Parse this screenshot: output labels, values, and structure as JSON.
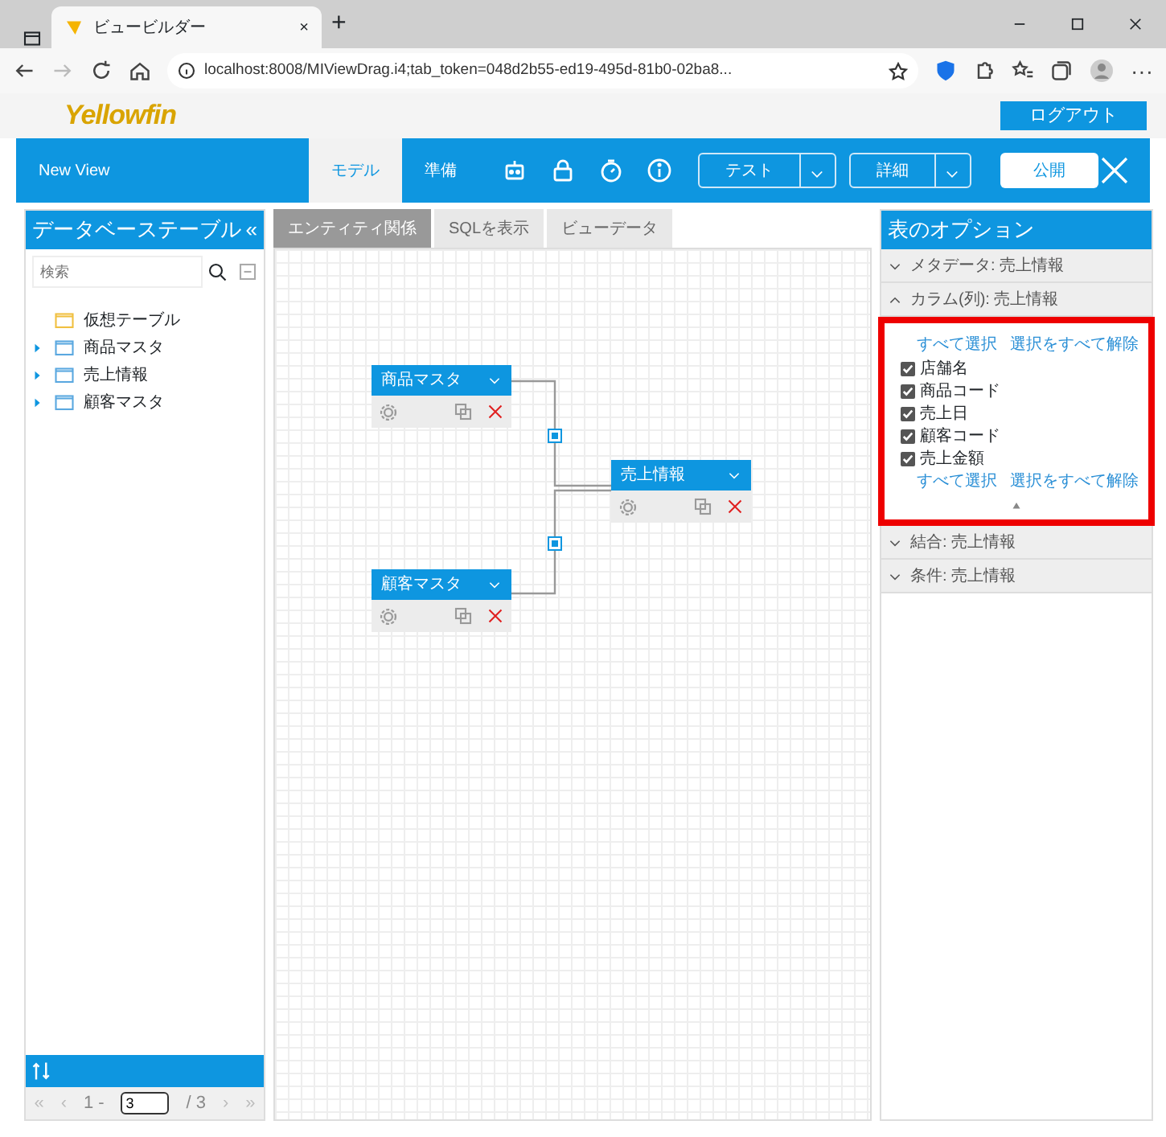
{
  "browser": {
    "tab_title": "ビュービルダー",
    "tab_close": "×",
    "new_tab": "+",
    "url": "localhost:8008/MIViewDrag.i4;tab_token=048d2b55-ed19-495d-81b0-02ba8...",
    "more": "···"
  },
  "app": {
    "logo": "Yellowfin",
    "logout": "ログアウト"
  },
  "toolbar": {
    "view_name": "New View",
    "tabs": [
      {
        "label": "モデル",
        "selected": true
      },
      {
        "label": "準備",
        "selected": false
      }
    ],
    "test": "テスト",
    "details": "詳細",
    "publish": "公開"
  },
  "left_panel": {
    "title": "データベーステーブル",
    "collapse": "«",
    "search": {
      "placeholder": "検索"
    },
    "items": [
      {
        "label": "仮想テーブル",
        "kind": "virtual"
      },
      {
        "label": "商品マスタ",
        "kind": "table"
      },
      {
        "label": "売上情報",
        "kind": "table"
      },
      {
        "label": "顧客マスタ",
        "kind": "table"
      }
    ],
    "pager": {
      "first": "«",
      "prev": "‹",
      "range": "1 -",
      "page": "3",
      "total": "/ 3",
      "next": "›",
      "last": "»"
    }
  },
  "canvas": {
    "tabs": [
      {
        "label": "エンティティ関係",
        "selected": true
      },
      {
        "label": "SQLを表示",
        "selected": false
      },
      {
        "label": "ビューデータ",
        "selected": false
      }
    ],
    "nodes": [
      {
        "title": "商品マスタ"
      },
      {
        "title": "売上情報"
      },
      {
        "title": "顧客マスタ"
      }
    ]
  },
  "right_panel": {
    "title": "表のオプション",
    "sections": [
      {
        "label": "メタデータ: 売上情報",
        "expanded": false
      },
      {
        "label": "カラム(列): 売上情報",
        "expanded": true,
        "highlighted": true,
        "top_links": [
          "すべて選択",
          "選択をすべて解除"
        ],
        "columns": [
          {
            "label": "店舗名",
            "checked": true
          },
          {
            "label": "商品コード",
            "checked": true
          },
          {
            "label": "売上日",
            "checked": true
          },
          {
            "label": "顧客コード",
            "checked": true
          },
          {
            "label": "売上金額",
            "checked": true
          }
        ],
        "bottom_links": [
          "すべて選択",
          "選択をすべて解除"
        ]
      },
      {
        "label": "結合: 売上情報",
        "expanded": false
      },
      {
        "label": "条件: 売上情報",
        "expanded": false
      }
    ]
  }
}
